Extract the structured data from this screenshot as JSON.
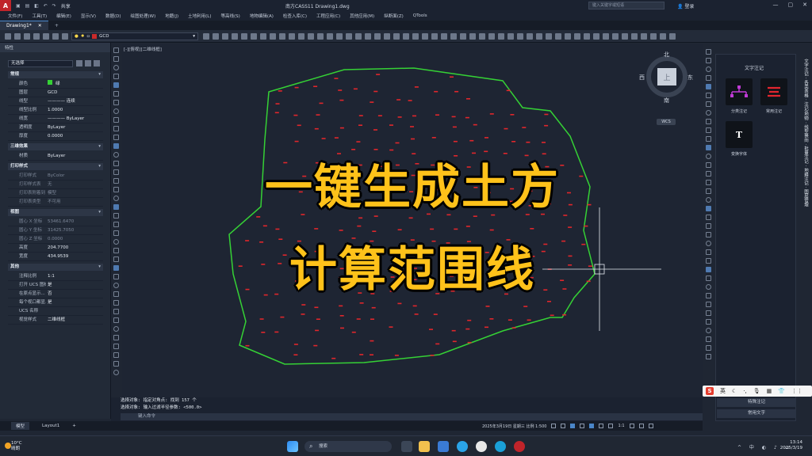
{
  "titlebar": {
    "logo": "A",
    "share": "共享",
    "title": "南方CASS11    Drawing1.dwg",
    "search_placeholder": "键入关键字或短语",
    "user": "登录"
  },
  "menu": [
    "文件(F)",
    "工具(T)",
    "编辑(E)",
    "显示(V)",
    "数据(D)",
    "绘图处理(W)",
    "地籍(J)",
    "土地利用(L)",
    "等高线(S)",
    "地物编辑(A)",
    "检查入库(C)",
    "工程应用(C)",
    "其他应用(M)",
    "纵断面(Z)",
    "QTools"
  ],
  "tabs": {
    "active": "Drawing1*"
  },
  "toolbar": {
    "layer_name": "GCD"
  },
  "properties": {
    "panel_title": "特性",
    "selection": "无选择",
    "general": {
      "title": "常规",
      "rows": [
        {
          "k": "颜色",
          "v": "绿"
        },
        {
          "k": "图层",
          "v": "GCD"
        },
        {
          "k": "线型",
          "v": "———— 连续"
        },
        {
          "k": "线型比例",
          "v": "1.0000"
        },
        {
          "k": "线宽",
          "v": "———— ByLayer"
        },
        {
          "k": "透明度",
          "v": "ByLayer"
        },
        {
          "k": "厚度",
          "v": "0.0000"
        }
      ]
    },
    "three_d": {
      "title": "三维效果",
      "rows": [
        {
          "k": "材质",
          "v": "ByLayer"
        }
      ]
    },
    "plot": {
      "title": "打印样式",
      "rows": [
        {
          "k": "打印样式",
          "v": "ByColor"
        },
        {
          "k": "打印样式表",
          "v": "无"
        },
        {
          "k": "打印表附着到",
          "v": "模型"
        },
        {
          "k": "打印表类型",
          "v": "不可用"
        }
      ]
    },
    "view": {
      "title": "视图",
      "rows": [
        {
          "k": "圆心 X 坐标",
          "v": "53461.6470"
        },
        {
          "k": "圆心 Y 坐标",
          "v": "31425.7050"
        },
        {
          "k": "圆心 Z 坐标",
          "v": "0.0000"
        },
        {
          "k": "高度",
          "v": "204.7700"
        },
        {
          "k": "宽度",
          "v": "434.9539"
        }
      ]
    },
    "misc": {
      "title": "其他",
      "rows": [
        {
          "k": "注释比例",
          "v": "1:1"
        },
        {
          "k": "打开 UCS 图标",
          "v": "是"
        },
        {
          "k": "在原点显示...",
          "v": "否"
        },
        {
          "k": "每个视口都显...",
          "v": "是"
        },
        {
          "k": "UCS 名称",
          "v": ""
        },
        {
          "k": "视觉样式",
          "v": "二维线框"
        }
      ]
    }
  },
  "canvas": {
    "view_label": "[-][俯视][二维线框]",
    "overlay_line1": "一键生成土方",
    "overlay_line2": "计算范围线",
    "compass": {
      "north": "北",
      "south": "南",
      "east": "东",
      "west": "西",
      "top": "上",
      "wcs": "WCS"
    }
  },
  "colors": {
    "boundary": "#35d135",
    "points": "#e0262b",
    "overlay": "#ffc21a"
  },
  "command": {
    "history1": "选择对象: 指定对角点: 找到 157 个",
    "history2": "选择对象: 输入过滤半径参数: <500.0>",
    "prompt": "键入命令"
  },
  "layouts": [
    "模型",
    "Layout1"
  ],
  "status": {
    "text": "2025年3月19日 星期三 比例 1:500",
    "scale": "1:1"
  },
  "right_panel": {
    "title": "文字注记",
    "cards": [
      {
        "label": "分类注记"
      },
      {
        "label": "常用注记"
      },
      {
        "label": "变换字体",
        "glyph": "T"
      }
    ],
    "vertical_text": "文字注记 · 各类表格 · 注记/地物 · 线型换向 · 批量注记 · 地籍注记 · 图层管理",
    "bottom_btn1": "特殊注记",
    "bottom_btn2": "常用文字"
  },
  "ime": {
    "logo": "S",
    "label": "英"
  },
  "taskbar": {
    "temp": "10°C",
    "weather": "晴朗",
    "search": "搜索",
    "time": "13:14",
    "date": "2025/3/19"
  }
}
